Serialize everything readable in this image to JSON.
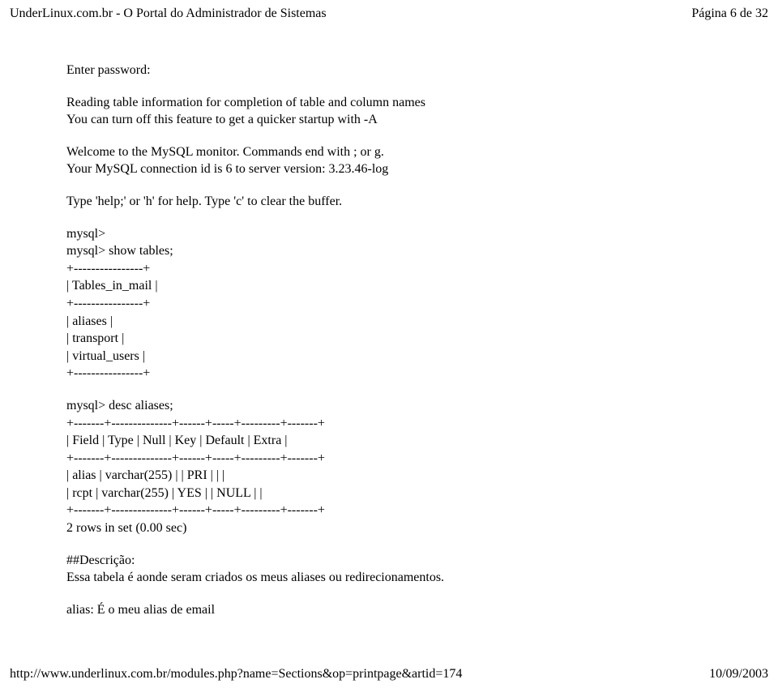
{
  "header": {
    "left": "UnderLinux.com.br - O Portal do Administrador de Sistemas",
    "right": "Página 6 de 32"
  },
  "content": {
    "p1": "Enter password:",
    "p2a": "Reading table information for completion of table and column names",
    "p2b": "You can turn off this feature to get a quicker startup with -A",
    "p3a": "Welcome to the MySQL monitor. Commands end with ; or g.",
    "p3b": "Your MySQL connection id is 6 to server version: 3.23.46-log",
    "p4": "Type 'help;' or 'h' for help. Type 'c' to clear the buffer.",
    "s1": "mysql>",
    "s2": "mysql> show tables;",
    "s3": "+----------------+",
    "s4": "| Tables_in_mail |",
    "s5": "+----------------+",
    "s6": "| aliases |",
    "s7": "| transport |",
    "s8": "| virtual_users |",
    "s9": "+----------------+",
    "d1": "mysql> desc aliases;",
    "d2": "+-------+--------------+------+-----+---------+-------+",
    "d3": "| Field | Type | Null | Key | Default | Extra |",
    "d4": "+-------+--------------+------+-----+---------+-------+",
    "d5": "| alias | varchar(255) | | PRI | | |",
    "d6": "| rcpt | varchar(255) | YES | | NULL | |",
    "d7": "+-------+--------------+------+-----+---------+-------+",
    "d8": "2 rows in set (0.00 sec)",
    "desc1": "##Descrição:",
    "desc2": "Essa tabela é aonde seram criados os meus aliases ou redirecionamentos.",
    "alias": "alias: É o meu alias de email"
  },
  "footer": {
    "left": "http://www.underlinux.com.br/modules.php?name=Sections&op=printpage&artid=174",
    "right": "10/09/2003"
  }
}
